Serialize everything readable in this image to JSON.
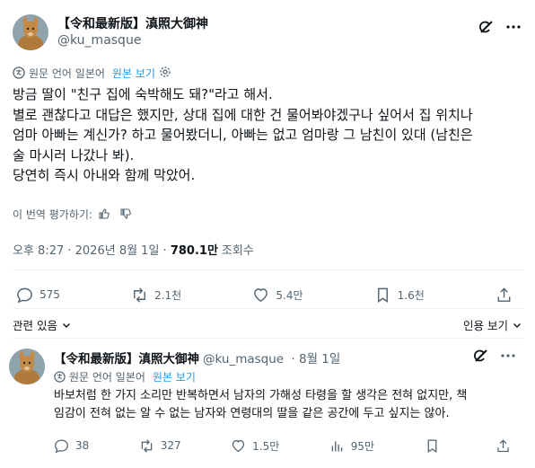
{
  "tweet": {
    "author": {
      "name": "【令和最新版】滇照大御神",
      "handle": "@ku_masque"
    },
    "translate": {
      "label": "원문 언어 일본어",
      "show_original": "원본 보기"
    },
    "text_lines": [
      "방금 딸이 \"친구 집에 숙박해도 돼?\"라고 해서.",
      "별로 괜찮다고 대답은 했지만, 상대 집에 대한 건 물어봐야겠구나 싶어서 집 위치나",
      "엄마 아빠는 계신가? 하고 물어봤더니, 아빠는 없고 엄마랑 그 남친이 있대 (남친은",
      "술 마시러 나갔나 봐).",
      "당연히 즉시 아내와 함께 막았어."
    ],
    "rate_prompt": "이 번역 평가하기:",
    "meta": {
      "time_date": "오후 8:27 · 2026년 8월 1일 ·",
      "views": "780.1만",
      "views_label": "조회수"
    },
    "actions": {
      "replies": "575",
      "reposts": "2.1천",
      "likes": "5.4만",
      "bookmarks": "1.6천"
    },
    "related_label": "관련 있음",
    "quotes_label": "인용 보기"
  },
  "reply": {
    "author": {
      "name": "【令和最新版】滇照大御神",
      "handle": "@ku_masque",
      "date": "· 8월 1일"
    },
    "translate": {
      "label": "원문 언어 일본어",
      "show_original": "원본 보기"
    },
    "text_lines": [
      "바보처럼 한 가지 소리만 반복하면서 남자의 가해성 타령을 할 생각은 전혀 없지만, 책",
      "임감이 전혀 없는 알 수 없는 남자와 연령대의 딸을 같은 공간에 두고 싶지는 않아."
    ],
    "actions": {
      "replies": "38",
      "reposts": "327",
      "likes": "1.5만",
      "views": "95만"
    }
  },
  "colors": {
    "accent": "#1d9bf0",
    "muted": "#536471",
    "text": "#0f1419",
    "divider": "#eff3f4"
  },
  "icons": [
    "grok-icon",
    "more-icon",
    "translate-icon",
    "gear-icon",
    "thumbs-up-icon",
    "thumbs-down-icon",
    "reply-icon",
    "repost-icon",
    "like-icon",
    "views-icon",
    "bookmark-icon",
    "share-icon",
    "chevron-down-icon"
  ]
}
